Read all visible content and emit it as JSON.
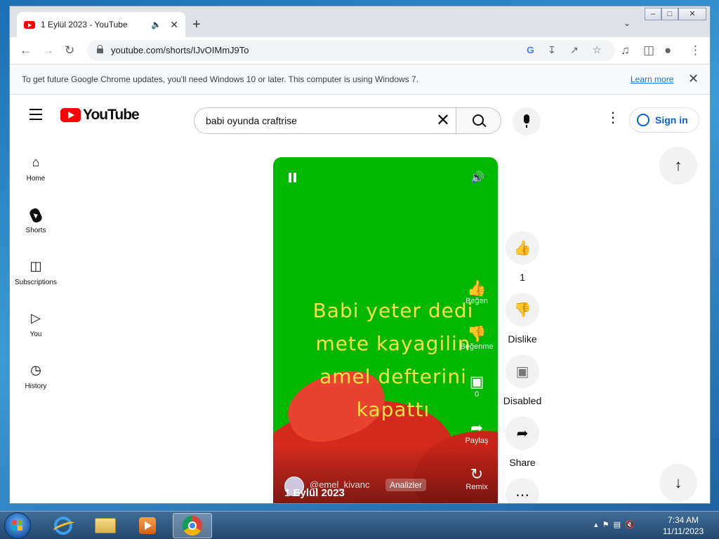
{
  "browser": {
    "tab_title": "1 Eylül 2023 - YouTube",
    "url": "youtube.com/shorts/IJvOIMmJ9To",
    "infobar_message": "To get future Google Chrome updates, you'll need Windows 10 or later. This computer is using Windows 7.",
    "infobar_link": "Learn more"
  },
  "youtube": {
    "logo_text": "YouTube",
    "search_query": "babi oyunda craftrise",
    "sign_in": "Sign in",
    "sidebar": [
      {
        "label": "Home"
      },
      {
        "label": "Shorts"
      },
      {
        "label": "Subscriptions"
      },
      {
        "label": "You"
      },
      {
        "label": "History"
      }
    ],
    "video": {
      "caption_lines": [
        "Babi yeter dedi",
        "mete kayagilin",
        "amel defterini",
        "kapattı"
      ],
      "overlay": {
        "like": "Beğen",
        "dislike": "Beğenme",
        "comments": "0",
        "share": "Paylaş",
        "remix": "Remix"
      },
      "date_text": "1 Eylül 2023",
      "channel": "@emel_kivanc",
      "analytics": "Analizler"
    },
    "actions": {
      "like_count": "1",
      "dislike": "Dislike",
      "comments": "Disabled",
      "share": "Share"
    }
  },
  "taskbar": {
    "time": "7:34 AM",
    "date": "11/11/2023"
  },
  "colors": {
    "youtube_red": "#ff0000",
    "video_green": "#00b800",
    "caption_yellow": "#f4e04a",
    "link_blue": "#065fd4"
  }
}
